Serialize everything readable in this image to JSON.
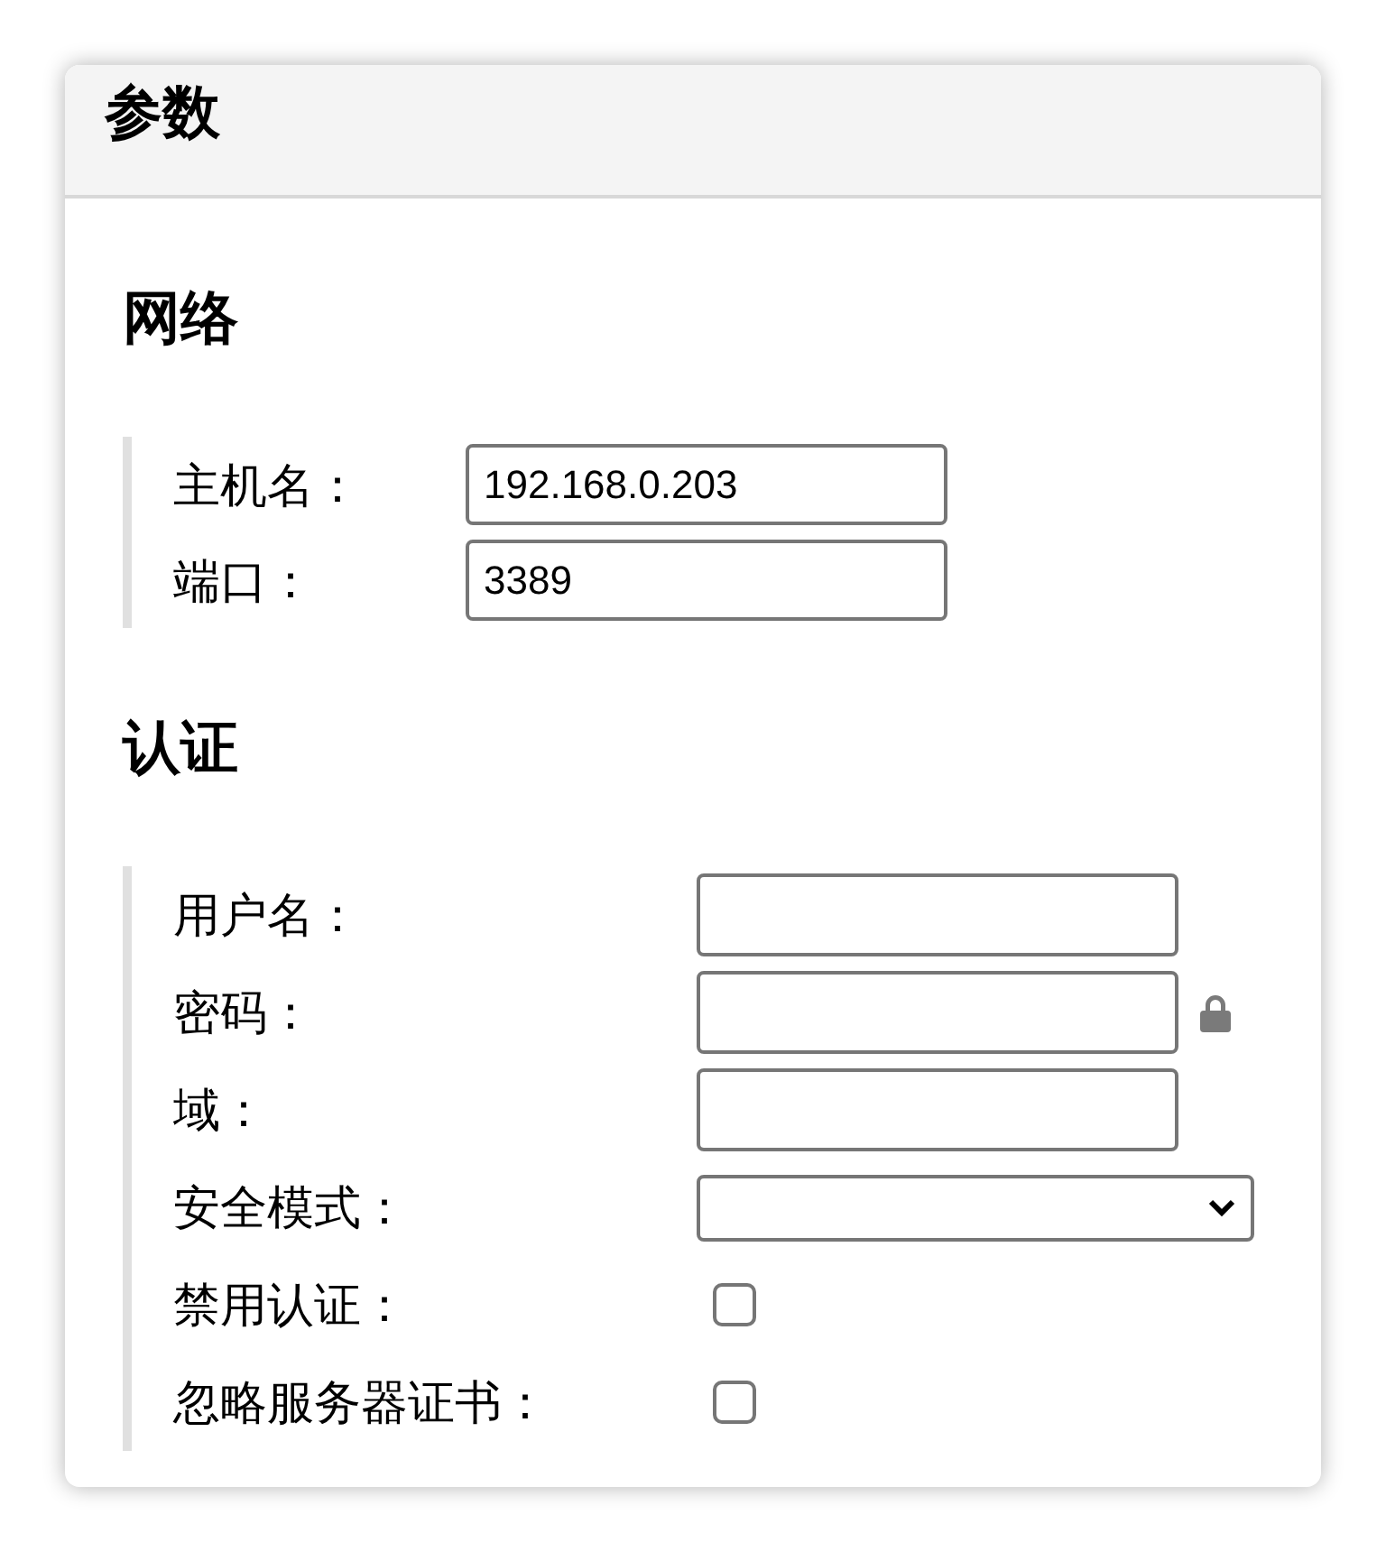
{
  "title": "参数",
  "sections": [
    {
      "heading": "网络",
      "fields": [
        {
          "kind": "text",
          "label": "主机名：",
          "value": "192.168.0.203"
        },
        {
          "kind": "text",
          "label": "端口：",
          "value": "3389"
        }
      ]
    },
    {
      "heading": "认证",
      "fields": [
        {
          "kind": "text",
          "label": "用户名："
        },
        {
          "kind": "password",
          "label": "密码："
        },
        {
          "kind": "text",
          "label": "域："
        },
        {
          "kind": "select",
          "label": "安全模式："
        },
        {
          "kind": "checkbox",
          "label": "禁用认证：",
          "checked": false
        },
        {
          "kind": "checkbox",
          "label": "忽略服务器证书：",
          "checked": false
        }
      ]
    }
  ]
}
